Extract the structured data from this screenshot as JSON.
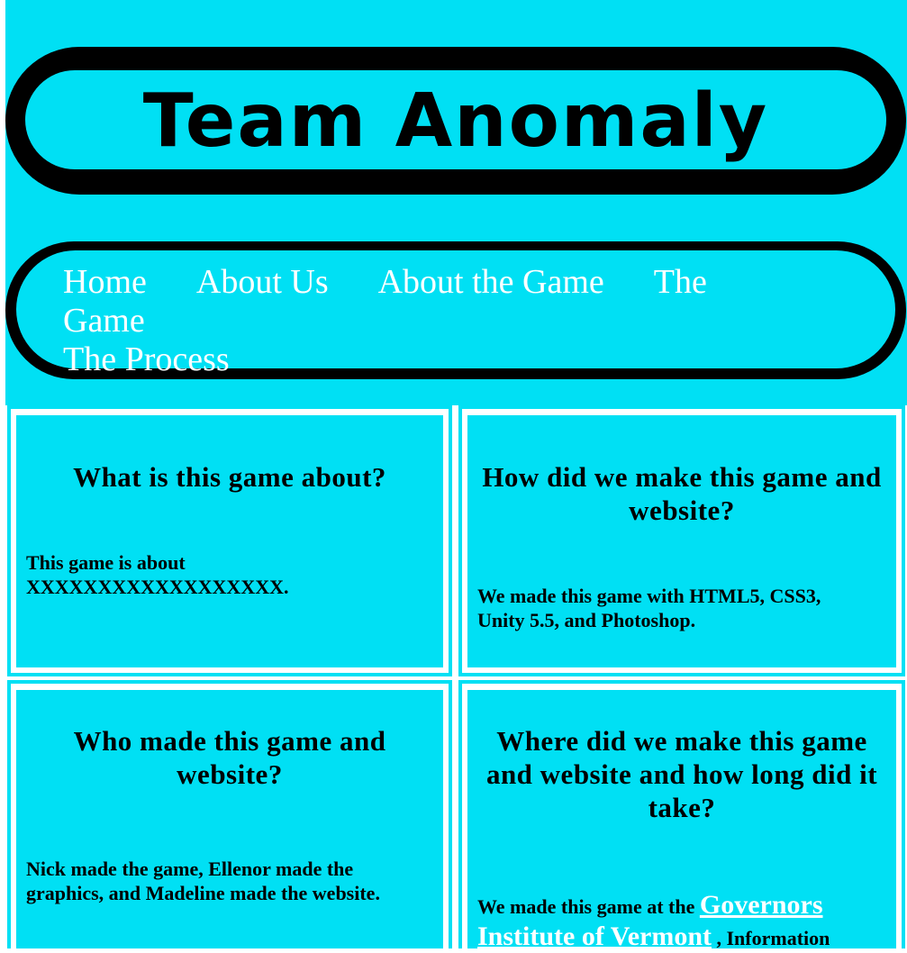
{
  "header": {
    "title": "Team Anomaly"
  },
  "nav": {
    "items": [
      {
        "label": "Home"
      },
      {
        "label": "About Us"
      },
      {
        "label": "About the Game"
      },
      {
        "label": "The Game"
      },
      {
        "label": "The Process"
      }
    ]
  },
  "sections": [
    {
      "heading": "What is this game about?",
      "body": "This game is about XXXXXXXXXXXXXXXXXX."
    },
    {
      "heading": "How did we make this game and website?",
      "body": "We made this game with HTML5, CSS3, Unity 5.5, and Photoshop."
    },
    {
      "heading": "Who made this game and website?",
      "body": "Nick made the game, Ellenor made the graphics, and Madeline made the website."
    },
    {
      "heading": "Where did we make this game and website and how long did it take?",
      "body_before_link": "We made this game at the ",
      "link": "Governors Institute of Vermont",
      "body_after_link": " , Information"
    }
  ],
  "colors": {
    "background": "#00e0f4",
    "frame": "#ffffff",
    "banner_border": "#000000",
    "nav_text": "#ffffff"
  }
}
